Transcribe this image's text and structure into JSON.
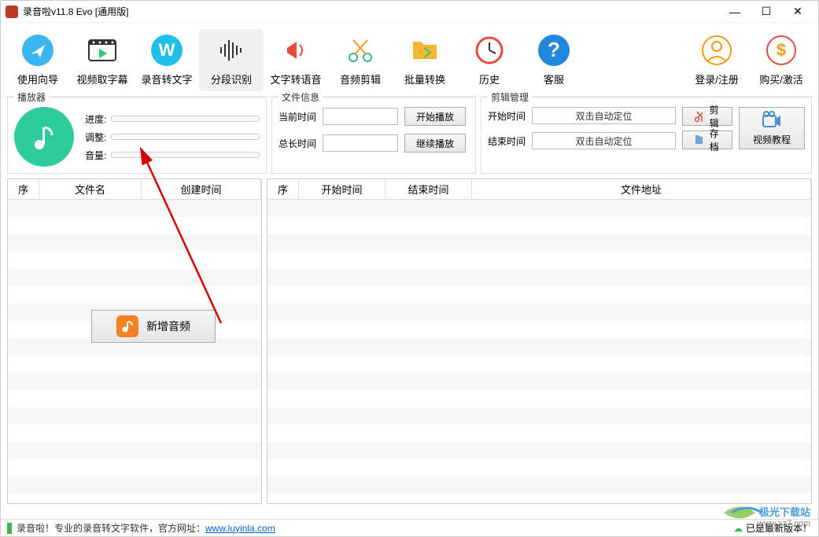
{
  "window": {
    "title": "录音啦v11.8 Evo [通用版]"
  },
  "toolbar": {
    "guide": "使用向导",
    "video_sub": "视频取字幕",
    "audio_text": "录音转文字",
    "segment": "分段识别",
    "tts": "文字转语音",
    "audio_edit": "音频剪辑",
    "batch": "批量转换",
    "history": "历史",
    "service": "客服",
    "login": "登录/注册",
    "buy": "购买/激活"
  },
  "player": {
    "legend": "播放器",
    "progress_label": "进度:",
    "speed_label": "调整:",
    "volume_label": "音量:"
  },
  "fileinfo": {
    "legend": "文件信息",
    "current_time_label": "当前时间",
    "total_time_label": "总长时间",
    "play_btn": "开始播放",
    "continue_btn": "继续播放"
  },
  "editmgr": {
    "legend": "剪辑管理",
    "start_label": "开始时间",
    "end_label": "结束时间",
    "placeholder": "双击自动定位",
    "cut_btn": "剪辑",
    "archive_btn": "存档",
    "video_tutorial": "视频教程"
  },
  "table_left": {
    "col_seq": "序",
    "col_filename": "文件名",
    "col_created": "创建时间"
  },
  "table_right": {
    "col_seq": "序",
    "col_start": "开始时间",
    "col_end": "结束时间",
    "col_path": "文件地址"
  },
  "add_audio": {
    "label": "新增音频"
  },
  "status": {
    "text_prefix": "录音啦！专业的录音转文字软件，官方网址：",
    "url": "www.luyinla.com",
    "latest": "已是最新版本！"
  },
  "watermark": {
    "line1": "极光下载站",
    "line2": "www.xz7.com"
  }
}
